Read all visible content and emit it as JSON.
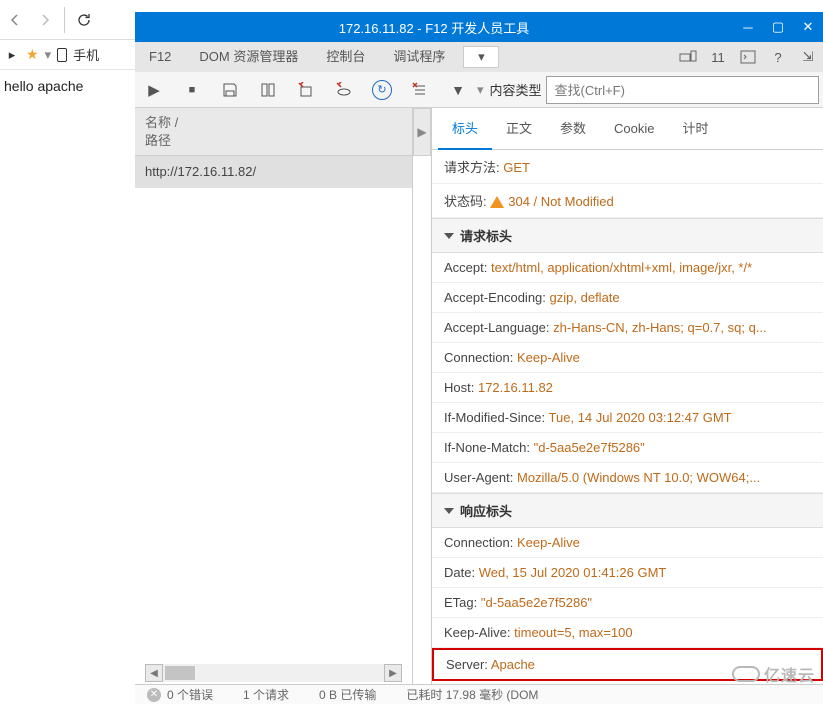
{
  "browser": {
    "phone_label": "手机",
    "page_text": "hello apache"
  },
  "devtools": {
    "title": "172.16.11.82 - F12 开发人员工具",
    "tabs": {
      "f12": "F12",
      "dom": "DOM 资源管理器",
      "console": "控制台",
      "debugger": "调试程序"
    },
    "right_count": "11"
  },
  "toolbar": {
    "content_type": "内容类型",
    "search_ph": "查找(Ctrl+F)"
  },
  "net": {
    "hdr_name": "名称 /",
    "hdr_path": "路径",
    "row_url": "http://172.16.11.82/"
  },
  "detail": {
    "tabs": {
      "headers": "标头",
      "body": "正文",
      "params": "参数",
      "cookie": "Cookie",
      "timing": "计时"
    },
    "req_method_k": "请求方法:",
    "req_method_v": "GET",
    "status_k": "状态码:",
    "status_v": "304 / Not Modified",
    "sec_req": "请求标头",
    "sec_res": "响应标头",
    "req": {
      "accept_k": "Accept:",
      "accept_v": "text/html, application/xhtml+xml, image/jxr, */*",
      "ae_k": "Accept-Encoding:",
      "ae_v": "gzip, deflate",
      "al_k": "Accept-Language:",
      "al_v": "zh-Hans-CN, zh-Hans; q=0.7, sq; q...",
      "conn_k": "Connection:",
      "conn_v": "Keep-Alive",
      "host_k": "Host:",
      "host_v": "172.16.11.82",
      "ims_k": "If-Modified-Since:",
      "ims_v": "Tue, 14 Jul 2020 03:12:47 GMT",
      "inm_k": "If-None-Match:",
      "inm_v": "\"d-5aa5e2e7f5286\"",
      "ua_k": "User-Agent:",
      "ua_v": "Mozilla/5.0 (Windows NT 10.0; WOW64;..."
    },
    "res": {
      "conn_k": "Connection:",
      "conn_v": "Keep-Alive",
      "date_k": "Date:",
      "date_v": "Wed, 15 Jul 2020 01:41:26 GMT",
      "etag_k": "ETag:",
      "etag_v": "\"d-5aa5e2e7f5286\"",
      "ka_k": "Keep-Alive:",
      "ka_v": "timeout=5, max=100",
      "srv_k": "Server:",
      "srv_v": "Apache"
    }
  },
  "status": {
    "errors": "0 个错误",
    "requests": "1 个请求",
    "transferred": "0 B 已传输",
    "timing": "已耗时 17.98 毫秒 (DOM"
  },
  "watermark": "亿速云"
}
